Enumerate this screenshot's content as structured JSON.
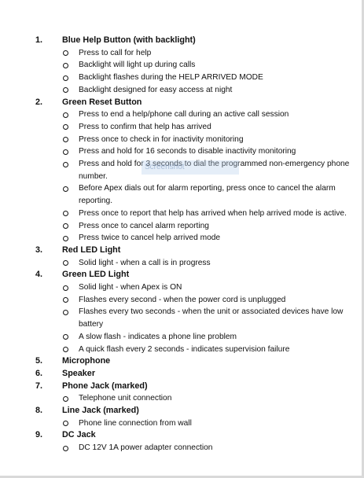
{
  "items": [
    {
      "num": "1.",
      "title": "Blue Help Button (with backlight)",
      "subs": [
        "Press to call for help",
        "Backlight will light up during calls",
        "Backlight flashes during the HELP ARRIVED MODE",
        "Backlight designed for easy access at night"
      ]
    },
    {
      "num": "2.",
      "title": "Green Reset Button",
      "subs": [
        "Press to end a help/phone call during an active call session",
        "Press to confirm that help has arrived",
        "Press once to check in for inactivity monitoring",
        "Press and hold for 16 seconds to disable inactivity monitoring",
        "Press and hold for 3 seconds to dial the programmed non-emergency phone number.",
        "Before Apex dials out for alarm reporting, press once to cancel the alarm reporting.",
        "Press once to report that help has arrived when help arrived mode is active.",
        "Press once to cancel alarm reporting",
        "Press twice to cancel help arrived mode"
      ]
    },
    {
      "num": "3.",
      "title": "Red LED Light",
      "subs": [
        "Solid light - when a call is in progress"
      ]
    },
    {
      "num": "4.",
      "title": "Green LED Light",
      "subs": [
        "Solid light - when Apex is ON",
        "Flashes every second - when the power cord is unplugged",
        "Flashes every two seconds - when the unit or associated devices have low battery",
        "A slow flash - indicates a phone line problem",
        "A quick flash every 2 seconds - indicates supervision failure"
      ]
    },
    {
      "num": "5.",
      "title": "Microphone",
      "subs": []
    },
    {
      "num": "6.",
      "title": "Speaker",
      "subs": []
    },
    {
      "num": "7.",
      "title": "Phone Jack (marked)",
      "subs": [
        "Telephone unit connection"
      ]
    },
    {
      "num": "8.",
      "title": "Line Jack (marked)",
      "subs": [
        "Phone line connection from wall"
      ]
    },
    {
      "num": "9.",
      "title": "DC Jack",
      "subs": [
        "DC 12V 1A power adapter connection"
      ]
    }
  ],
  "watermark_text": "Screenshot"
}
